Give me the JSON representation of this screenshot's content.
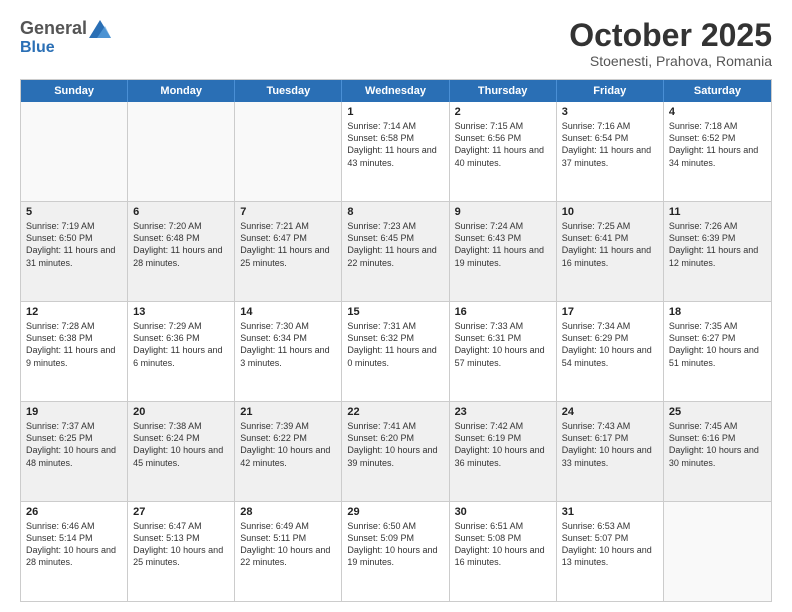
{
  "logo": {
    "general": "General",
    "blue": "Blue"
  },
  "header": {
    "month": "October 2025",
    "location": "Stoenesti, Prahova, Romania"
  },
  "days": [
    "Sunday",
    "Monday",
    "Tuesday",
    "Wednesday",
    "Thursday",
    "Friday",
    "Saturday"
  ],
  "weeks": [
    [
      {
        "day": "",
        "text": "",
        "empty": true
      },
      {
        "day": "",
        "text": "",
        "empty": true
      },
      {
        "day": "",
        "text": "",
        "empty": true
      },
      {
        "day": "1",
        "text": "Sunrise: 7:14 AM\nSunset: 6:58 PM\nDaylight: 11 hours\nand 43 minutes."
      },
      {
        "day": "2",
        "text": "Sunrise: 7:15 AM\nSunset: 6:56 PM\nDaylight: 11 hours\nand 40 minutes."
      },
      {
        "day": "3",
        "text": "Sunrise: 7:16 AM\nSunset: 6:54 PM\nDaylight: 11 hours\nand 37 minutes."
      },
      {
        "day": "4",
        "text": "Sunrise: 7:18 AM\nSunset: 6:52 PM\nDaylight: 11 hours\nand 34 minutes."
      }
    ],
    [
      {
        "day": "5",
        "text": "Sunrise: 7:19 AM\nSunset: 6:50 PM\nDaylight: 11 hours\nand 31 minutes.",
        "shaded": true
      },
      {
        "day": "6",
        "text": "Sunrise: 7:20 AM\nSunset: 6:48 PM\nDaylight: 11 hours\nand 28 minutes.",
        "shaded": true
      },
      {
        "day": "7",
        "text": "Sunrise: 7:21 AM\nSunset: 6:47 PM\nDaylight: 11 hours\nand 25 minutes.",
        "shaded": true
      },
      {
        "day": "8",
        "text": "Sunrise: 7:23 AM\nSunset: 6:45 PM\nDaylight: 11 hours\nand 22 minutes.",
        "shaded": true
      },
      {
        "day": "9",
        "text": "Sunrise: 7:24 AM\nSunset: 6:43 PM\nDaylight: 11 hours\nand 19 minutes.",
        "shaded": true
      },
      {
        "day": "10",
        "text": "Sunrise: 7:25 AM\nSunset: 6:41 PM\nDaylight: 11 hours\nand 16 minutes.",
        "shaded": true
      },
      {
        "day": "11",
        "text": "Sunrise: 7:26 AM\nSunset: 6:39 PM\nDaylight: 11 hours\nand 12 minutes.",
        "shaded": true
      }
    ],
    [
      {
        "day": "12",
        "text": "Sunrise: 7:28 AM\nSunset: 6:38 PM\nDaylight: 11 hours\nand 9 minutes."
      },
      {
        "day": "13",
        "text": "Sunrise: 7:29 AM\nSunset: 6:36 PM\nDaylight: 11 hours\nand 6 minutes."
      },
      {
        "day": "14",
        "text": "Sunrise: 7:30 AM\nSunset: 6:34 PM\nDaylight: 11 hours\nand 3 minutes."
      },
      {
        "day": "15",
        "text": "Sunrise: 7:31 AM\nSunset: 6:32 PM\nDaylight: 11 hours\nand 0 minutes."
      },
      {
        "day": "16",
        "text": "Sunrise: 7:33 AM\nSunset: 6:31 PM\nDaylight: 10 hours\nand 57 minutes."
      },
      {
        "day": "17",
        "text": "Sunrise: 7:34 AM\nSunset: 6:29 PM\nDaylight: 10 hours\nand 54 minutes."
      },
      {
        "day": "18",
        "text": "Sunrise: 7:35 AM\nSunset: 6:27 PM\nDaylight: 10 hours\nand 51 minutes."
      }
    ],
    [
      {
        "day": "19",
        "text": "Sunrise: 7:37 AM\nSunset: 6:25 PM\nDaylight: 10 hours\nand 48 minutes.",
        "shaded": true
      },
      {
        "day": "20",
        "text": "Sunrise: 7:38 AM\nSunset: 6:24 PM\nDaylight: 10 hours\nand 45 minutes.",
        "shaded": true
      },
      {
        "day": "21",
        "text": "Sunrise: 7:39 AM\nSunset: 6:22 PM\nDaylight: 10 hours\nand 42 minutes.",
        "shaded": true
      },
      {
        "day": "22",
        "text": "Sunrise: 7:41 AM\nSunset: 6:20 PM\nDaylight: 10 hours\nand 39 minutes.",
        "shaded": true
      },
      {
        "day": "23",
        "text": "Sunrise: 7:42 AM\nSunset: 6:19 PM\nDaylight: 10 hours\nand 36 minutes.",
        "shaded": true
      },
      {
        "day": "24",
        "text": "Sunrise: 7:43 AM\nSunset: 6:17 PM\nDaylight: 10 hours\nand 33 minutes.",
        "shaded": true
      },
      {
        "day": "25",
        "text": "Sunrise: 7:45 AM\nSunset: 6:16 PM\nDaylight: 10 hours\nand 30 minutes.",
        "shaded": true
      }
    ],
    [
      {
        "day": "26",
        "text": "Sunrise: 6:46 AM\nSunset: 5:14 PM\nDaylight: 10 hours\nand 28 minutes."
      },
      {
        "day": "27",
        "text": "Sunrise: 6:47 AM\nSunset: 5:13 PM\nDaylight: 10 hours\nand 25 minutes."
      },
      {
        "day": "28",
        "text": "Sunrise: 6:49 AM\nSunset: 5:11 PM\nDaylight: 10 hours\nand 22 minutes."
      },
      {
        "day": "29",
        "text": "Sunrise: 6:50 AM\nSunset: 5:09 PM\nDaylight: 10 hours\nand 19 minutes."
      },
      {
        "day": "30",
        "text": "Sunrise: 6:51 AM\nSunset: 5:08 PM\nDaylight: 10 hours\nand 16 minutes."
      },
      {
        "day": "31",
        "text": "Sunrise: 6:53 AM\nSunset: 5:07 PM\nDaylight: 10 hours\nand 13 minutes."
      },
      {
        "day": "",
        "text": "",
        "empty": true
      }
    ]
  ]
}
